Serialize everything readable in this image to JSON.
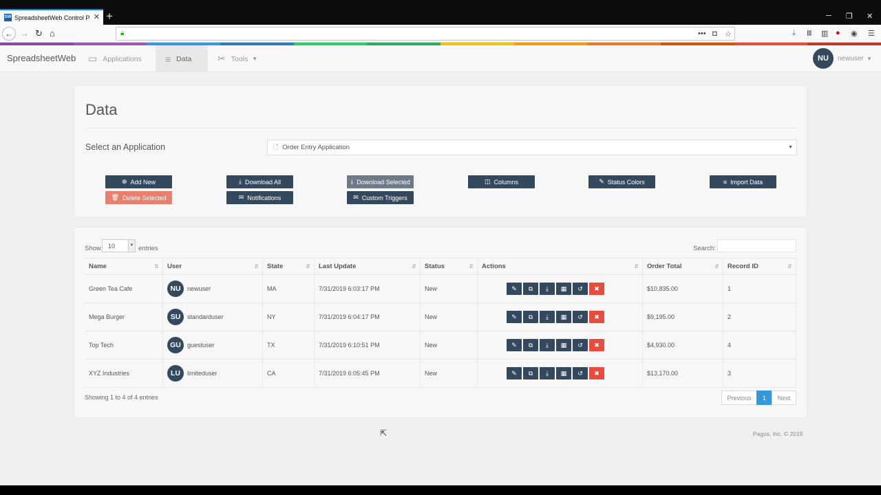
{
  "browser": {
    "tab_title": "SpreadsheetWeb Control Panel",
    "tab_favicon": "SW",
    "new_tab_icon": "+",
    "window": {
      "minimize": "─",
      "restore": "❐",
      "close": "✕"
    }
  },
  "rainbow": [
    "#8e44ad",
    "#9b59b6",
    "#3498db",
    "#2980b9",
    "#2ecc71",
    "#27ae60",
    "#f1c40f",
    "#f39c12",
    "#e67e22",
    "#d35400",
    "#e74c3c",
    "#c0392b"
  ],
  "header": {
    "brand": "SpreadsheetWeb",
    "nav": [
      {
        "label": "Applications",
        "icon": "window-icon"
      },
      {
        "label": "Data",
        "icon": "database-icon"
      },
      {
        "label": "Tools",
        "icon": "tools-icon"
      }
    ],
    "user_initials": "NU",
    "user_name": "newuser"
  },
  "page": {
    "title": "Data",
    "select_label": "Select an Application",
    "selected_application": "Order Entry Application"
  },
  "buttons": {
    "add_new": "Add New",
    "delete_selected": "Delete Selected",
    "download_all": "Download All",
    "notifications": "Notifications",
    "download_selected": "Download Selected",
    "custom_triggers": "Custom Triggers",
    "columns": "Columns",
    "status_colors": "Status Colors",
    "import_data": "Import Data"
  },
  "table": {
    "show_label": "Show",
    "page_length": "10",
    "entries_label": "entries",
    "search_label": "Search:",
    "columns": [
      "Name",
      "User",
      "State",
      "Last Update",
      "Status",
      "Actions",
      "Order Total",
      "Record ID"
    ],
    "rows": [
      {
        "name": "Green Tea Cafe",
        "initials": "NU",
        "user": "newuser",
        "state": "MA",
        "last_update": "7/31/2019 6:03:17 PM",
        "status": "New",
        "order_total": "$10,835.00",
        "record_id": "1"
      },
      {
        "name": "Mega Burger",
        "initials": "SU",
        "user": "standarduser",
        "state": "NY",
        "last_update": "7/31/2019 6:04:17 PM",
        "status": "New",
        "order_total": "$9,195.00",
        "record_id": "2"
      },
      {
        "name": "Top Tech",
        "initials": "GU",
        "user": "guestuser",
        "state": "TX",
        "last_update": "7/31/2019 6:10:51 PM",
        "status": "New",
        "order_total": "$4,930.00",
        "record_id": "4"
      },
      {
        "name": "XYZ Industries",
        "initials": "LU",
        "user": "limiteduser",
        "state": "CA",
        "last_update": "7/31/2019 6:05:45 PM",
        "status": "New",
        "order_total": "$13,170.00",
        "record_id": "3"
      }
    ],
    "info": "Showing 1 to 4 of 4 entries",
    "pagination": {
      "previous": "Previous",
      "current": "1",
      "next": "Next"
    }
  },
  "footer": "Pagos, Inc. © 2019"
}
